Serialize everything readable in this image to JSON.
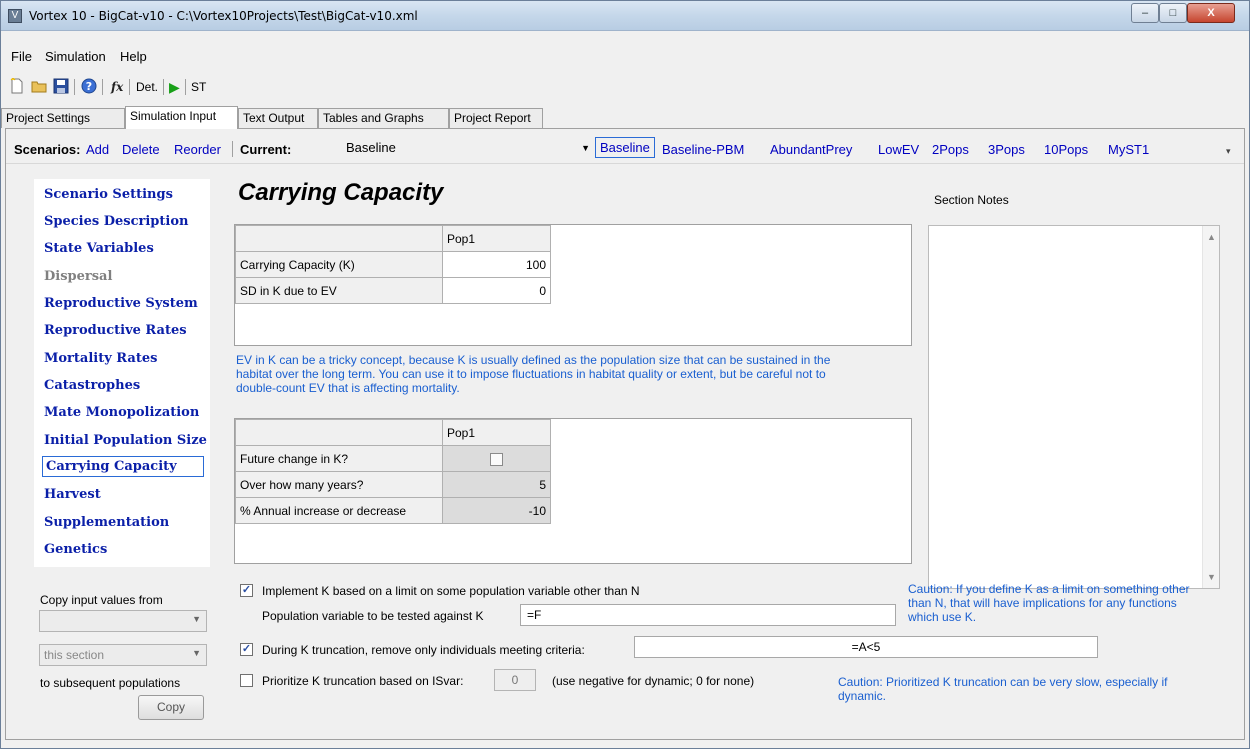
{
  "window": {
    "title": "Vortex 10 - BigCat-v10 - C:\\Vortex10Projects\\Test\\BigCat-v10.xml",
    "min": "–",
    "max": "□",
    "close": "X"
  },
  "menu": [
    "File",
    "Simulation",
    "Help"
  ],
  "toolbar": {
    "det": "Det.",
    "st": "ST",
    "run": "▶"
  },
  "tabs": [
    "Project Settings",
    "Simulation Input",
    "Text Output",
    "Tables and Graphs",
    "Project Report"
  ],
  "scenarios": {
    "label": "Scenarios:",
    "add": "Add",
    "delete": "Delete",
    "reorder": "Reorder",
    "current_label": "Current:",
    "current_value": "Baseline",
    "list": [
      "Baseline",
      "Baseline-PBM",
      "AbundantPrey",
      "LowEV",
      "2Pops",
      "3Pops",
      "10Pops",
      "MyST1"
    ]
  },
  "sidenav": [
    {
      "label": "Scenario Settings"
    },
    {
      "label": "Species Description"
    },
    {
      "label": "State Variables"
    },
    {
      "label": "Dispersal",
      "disabled": true
    },
    {
      "label": "Reproductive System"
    },
    {
      "label": "Reproductive Rates"
    },
    {
      "label": "Mortality Rates"
    },
    {
      "label": "Catastrophes"
    },
    {
      "label": "Mate Monopolization"
    },
    {
      "label": "Initial Population Size"
    },
    {
      "label": "Carrying Capacity",
      "selected": true
    },
    {
      "label": "Harvest"
    },
    {
      "label": "Supplementation"
    },
    {
      "label": "Genetics"
    }
  ],
  "copy": {
    "label": "Copy input values from",
    "combo1": "",
    "combo2": "this section",
    "to_label": "to subsequent populations",
    "button": "Copy"
  },
  "main": {
    "heading": "Carrying Capacity",
    "notes_label": "Section Notes",
    "grid1": {
      "col": "Pop1",
      "rows": [
        {
          "label": "Carrying Capacity (K)",
          "value": "100"
        },
        {
          "label": "SD in K due to EV",
          "value": "0"
        }
      ]
    },
    "ev_note": "EV in K can be a tricky concept, because K is usually defined as the population size that can be sustained in the habitat over the long term. You can use it  to impose fluctuations in habitat quality or extent, but be careful not to double-count EV that is affecting mortality.",
    "grid2": {
      "col": "Pop1",
      "rows": [
        {
          "label": "Future change in K?",
          "value": ""
        },
        {
          "label": "Over how many years?",
          "value": "5"
        },
        {
          "label": "% Annual increase or decrease",
          "value": "-10"
        }
      ]
    },
    "opt1_label": "Implement K based on a limit on some population variable other than N",
    "opt1_checked": true,
    "popvar_label": "Population variable to be tested against K",
    "popvar_value": "=F",
    "opt2_label": "During K truncation, remove only individuals meeting criteria:",
    "opt2_checked": true,
    "criteria_value": "=A<5",
    "opt3_label": "Prioritize K truncation based on ISvar:",
    "opt3_checked": false,
    "isvar_value": "0",
    "isvar_hint": "(use negative for dynamic; 0 for none)",
    "caution1": "Caution: If you define K as a limit on something other than N,  that will have implications for any functions which use K.",
    "caution2": "Caution: Prioritized K truncation can be very slow, especially if dynamic."
  }
}
